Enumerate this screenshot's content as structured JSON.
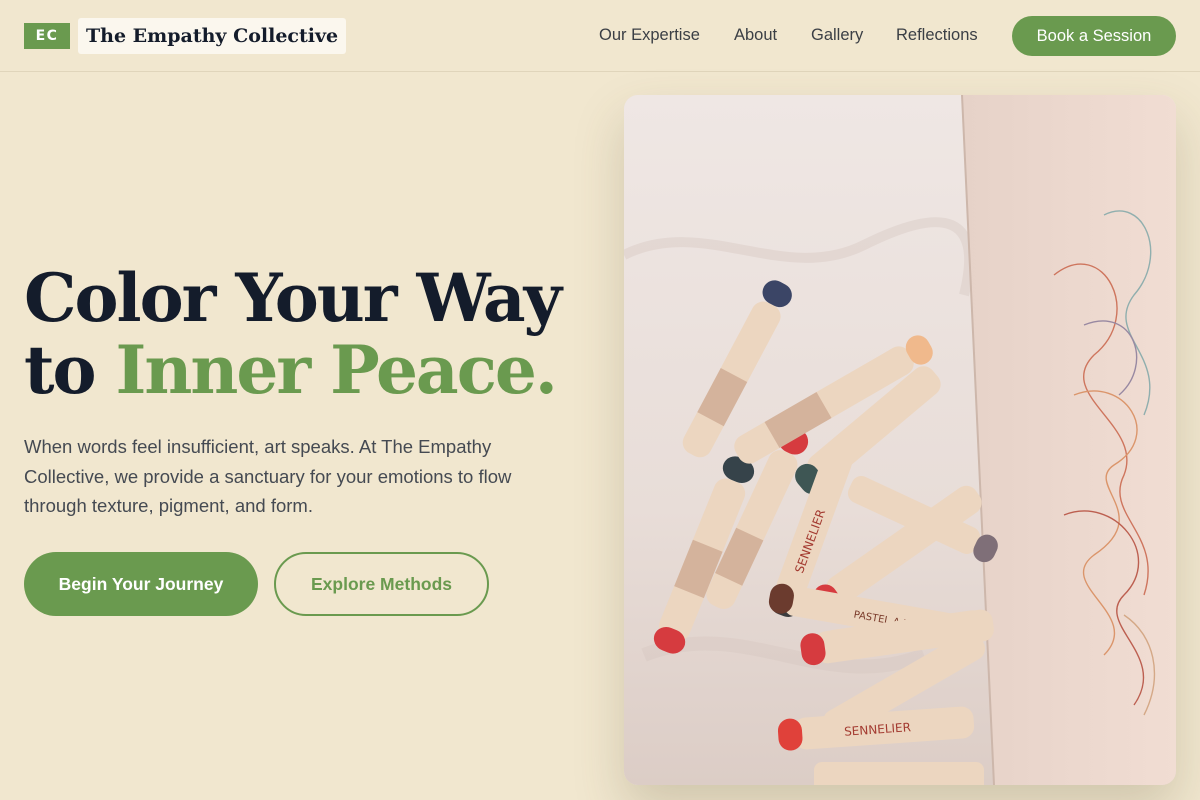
{
  "brand": {
    "badge": "EC",
    "name": "The Empathy Collective"
  },
  "nav": {
    "items": [
      {
        "label": "Our Expertise"
      },
      {
        "label": "About"
      },
      {
        "label": "Gallery"
      },
      {
        "label": "Reflections"
      }
    ],
    "cta": "Book a Session"
  },
  "hero": {
    "headline_line1": "Color Your Way",
    "headline_line2_prefix": "to",
    "headline_line2_accent": "Inner Peace.",
    "lede": "When words feel insufficient, art speaks. At The Empathy Collective, we provide a sanctuary for your emotions to flow through texture, pigment, and form.",
    "primary_button": "Begin Your Journey",
    "secondary_button": "Explore Methods"
  },
  "image": {
    "subject": "oil pastel sticks on white fabric beside a paper with colorful scribbles",
    "pastel_label": "SENNELIER",
    "pastel_sublabel": "PASTEL A L'HUILE"
  },
  "colors": {
    "accent": "#6a9a4f",
    "background": "#f1e7cf",
    "heading": "#141c2b",
    "body_text": "#454a52"
  },
  "icons": {
    "logo": "ec-monogram"
  }
}
